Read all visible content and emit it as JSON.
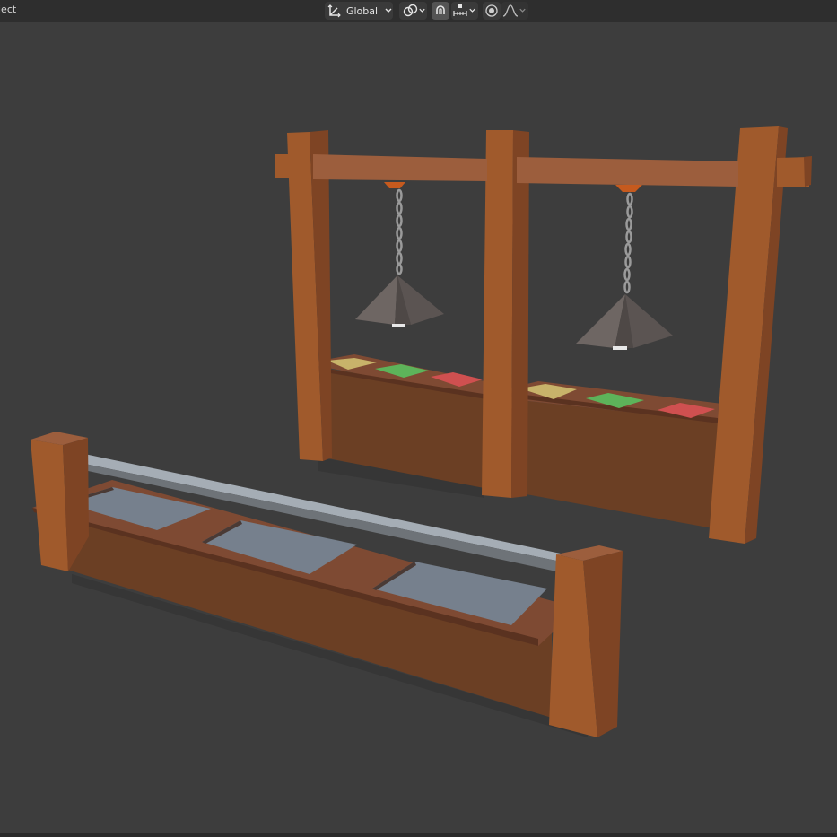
{
  "header": {
    "mode_label": "ject",
    "orientation": {
      "label": "Global",
      "icon": "transform-orientation-icon"
    },
    "pivot_icon": "pivot-point-icon",
    "snap_icon": "magnet-snap-icon",
    "snap_target_icon": "snap-increment-icon",
    "proportional_icon": "proportional-editing-icon",
    "falloff_icon": "falloff-curve-icon"
  },
  "viewport": {
    "background": "#3d3d3d",
    "objects": [
      "market-stall-with-lamps",
      "counter-with-glass-trays"
    ],
    "tray_colors": {
      "yellow": "#c8b36a",
      "green": "#5db35a",
      "red": "#cf5050",
      "glass": "#76808d"
    },
    "wood_colors": {
      "light": "#a05a2c",
      "dark": "#6b3f24",
      "mid": "#8a4f2c"
    }
  }
}
